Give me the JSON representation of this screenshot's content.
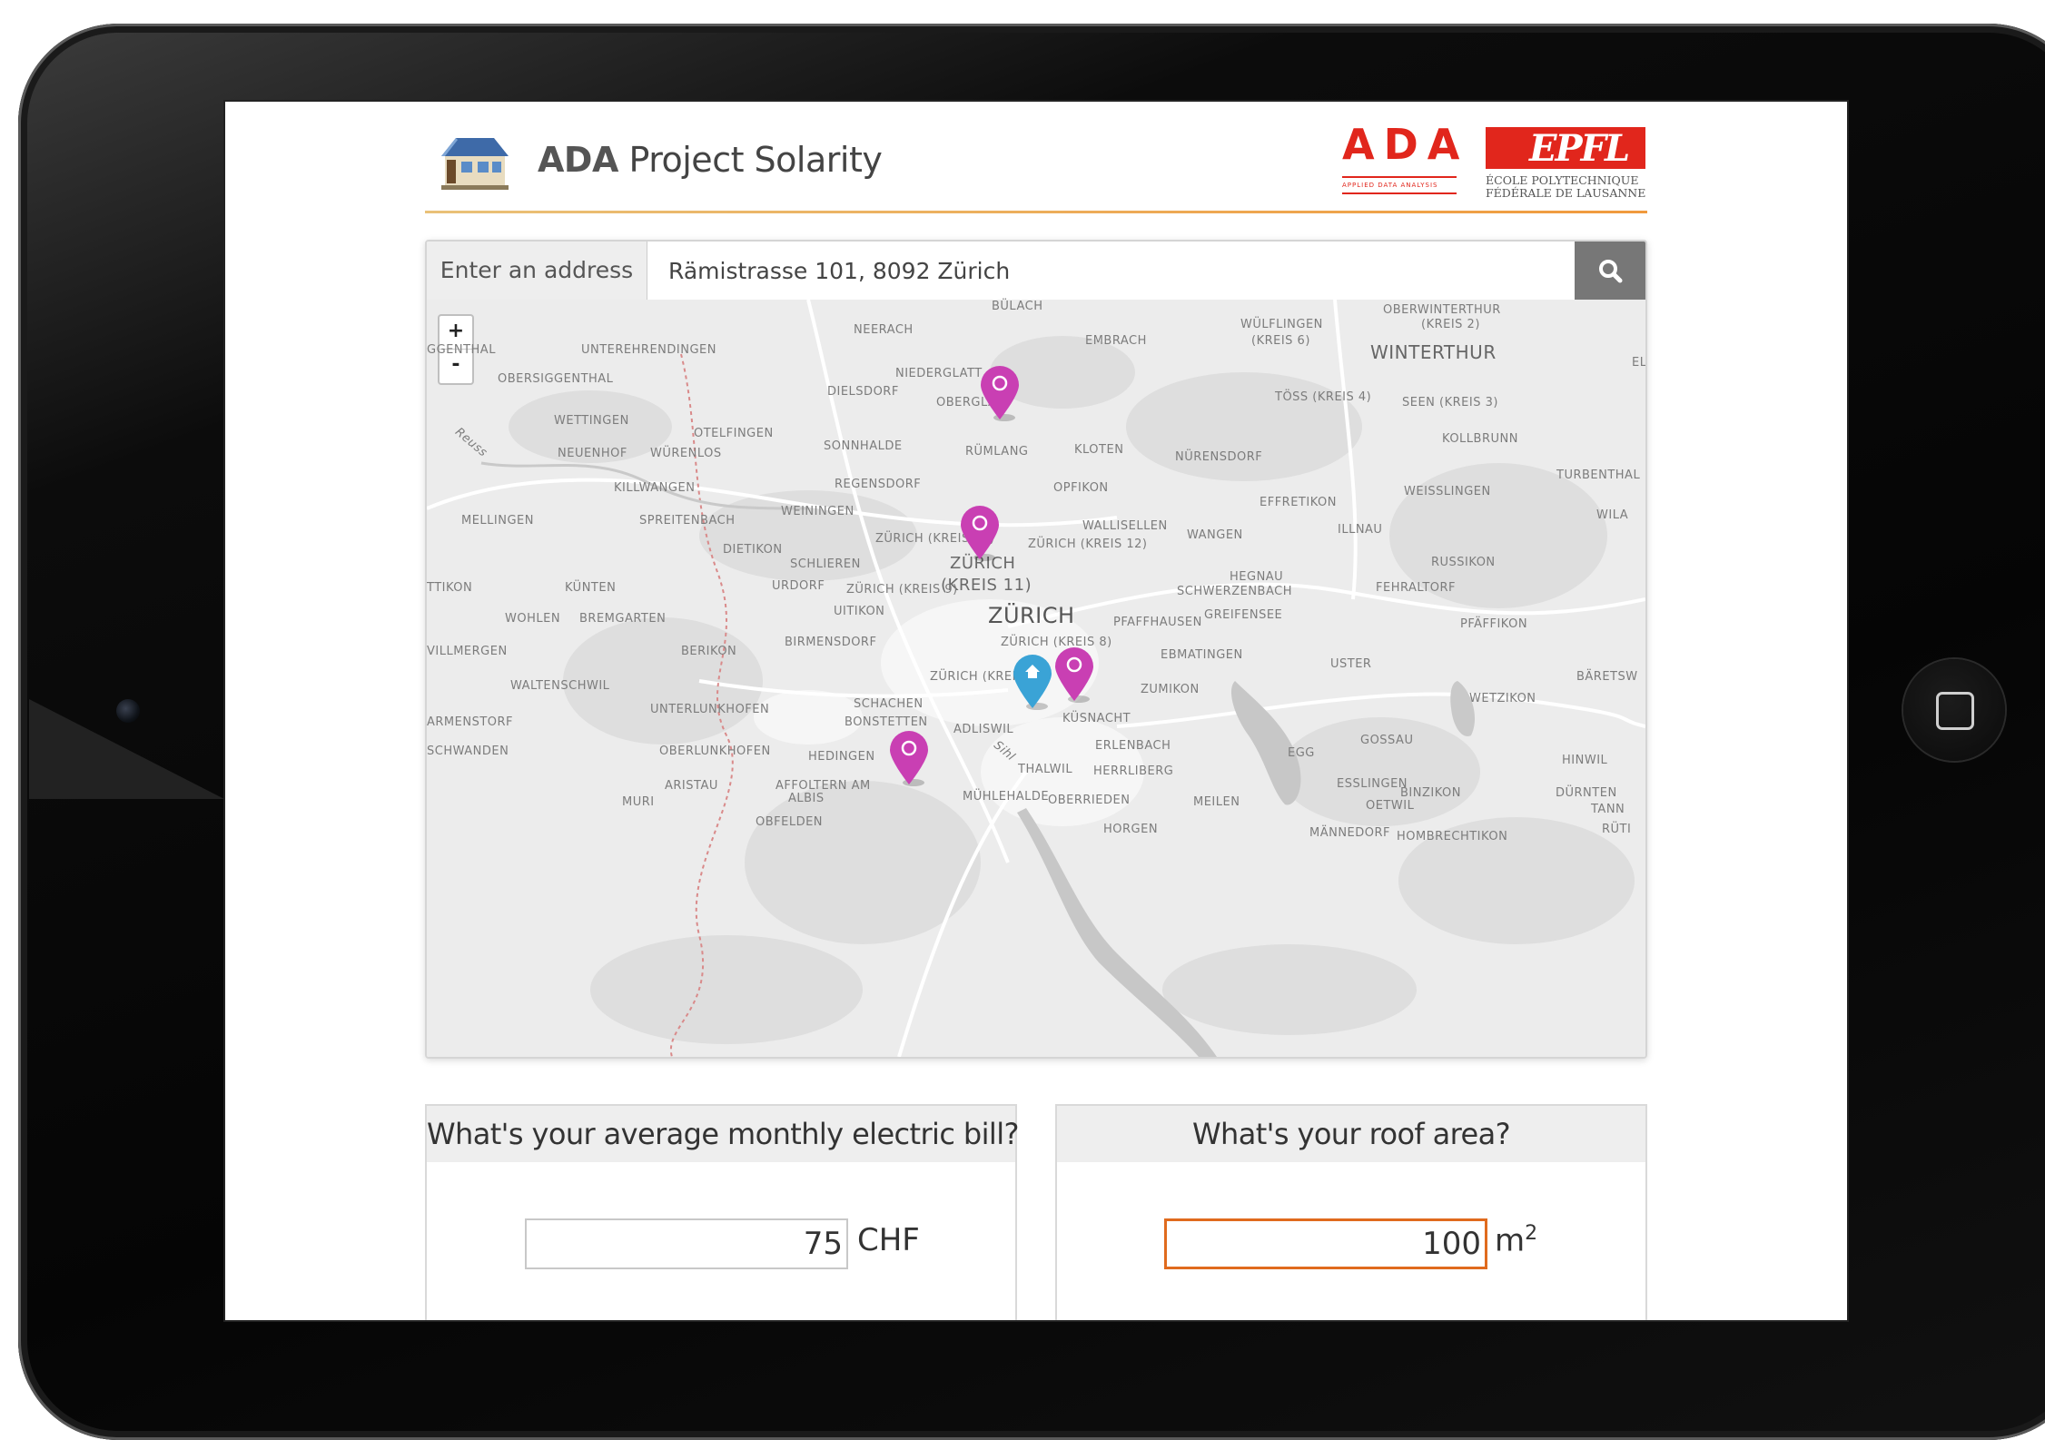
{
  "app": {
    "title_bold": "ADA",
    "title_rest": "Project Solarity"
  },
  "logos": {
    "ada_text": "ADA",
    "ada_subtitle": "APPLIED DATA ANALYSIS",
    "epfl_text": "EPFL",
    "epfl_subtitle": "ÉCOLE POLYTECHNIQUE\nFÉDÉRALE DE LAUSANNE"
  },
  "search": {
    "label": "Enter an address",
    "value": "Rämistrasse 101, 8092 Zürich",
    "button_icon": "search-icon"
  },
  "map": {
    "zoom_in": "+",
    "zoom_out": "-",
    "places": [
      "BÜLACH",
      "NEERACH",
      "EMBRACH",
      "WÜLFLINGEN",
      "(KREIS 6)",
      "OBERWINTERTHUR",
      "(KREIS 2)",
      "WINTERTHUR",
      "ELG",
      "GGENTHAL",
      "UNTEREHRENDINGEN",
      "OBERSIGGENTHAL",
      "NIEDERGLATT",
      "DIELSDORF",
      "OBERGLATT",
      "TÖSS (KREIS 4)",
      "SEEN (KREIS 3)",
      "WETTINGEN",
      "OTELFINGEN",
      "Reuss",
      "NEUENHOF",
      "WÜRENLOS",
      "SONNHALDE",
      "RÜMLANG",
      "KLOTEN",
      "NÜRENSDORF",
      "KOLLBRUNN",
      "TURBENTHAL",
      "KILLWANGEN",
      "REGENSDORF",
      "ZÜRICH",
      "(KREIS 11)",
      "OPFIKON",
      "EFFRETIKON",
      "WEISSLINGEN",
      "MELLINGEN",
      "SPREITENBACH",
      "WEININGEN",
      "WALLISELLEN",
      "WANGEN",
      "ILLNAU",
      "WILA",
      "ZÜRICH (KREIS 10)",
      "ZÜRICH (KREIS 12)",
      "DIETIKON",
      "RUSSIKON",
      "SCHLIEREN",
      "HEGNAU",
      "FEHRALTORF",
      "TTIKON",
      "KÜNTEN",
      "URDORF",
      "ZÜRICH (KREIS 9)",
      "ZÜRICH",
      "SCHWERZENBACH",
      "WOHLEN",
      "BREMGARTEN",
      "UITIKON",
      "PFAFFHAUSEN",
      "GREIFENSEE",
      "PFÄFFIKON",
      "BIRMENSDORF",
      "ZÜRICH (KREIS 8)",
      "VILLMERGEN",
      "BERIKON",
      "EBMATINGEN",
      "USTER",
      "ZÜRICH (KREIS 2)",
      "BÄRETSW",
      "WALTENSCHWIL",
      "ZUMIKON",
      "UNTERLUNKHOFEN",
      "SCHACHEN",
      "WETZIKON",
      "ARMENSTORF",
      "BONSTETTEN",
      "KÜSNACHT",
      "ADLISWIL",
      "Sihl",
      "GOSSAU",
      "SCHWANDEN",
      "OBERLUNKHOFEN",
      "HEDINGEN",
      "ERLENBACH",
      "EGG",
      "HINWIL",
      "ARISTAU",
      "THALWIL",
      "HERRLIBERG",
      "ESSLINGEN",
      "BINZIKON",
      "DÜRNTEN",
      "MURI",
      "AFFOLTERN AM",
      "ALBIS",
      "MÜHLEHALDE",
      "OBERRIEDEN",
      "MEILEN",
      "OETWIL",
      "TANN",
      "OBFELDEN",
      "HORGEN",
      "MÄNNEDORF",
      "HOMBRECHTIKON",
      "RÜTI"
    ]
  },
  "bill": {
    "question": "What's your average monthly electric bill?",
    "value": "75",
    "unit": "CHF"
  },
  "roof": {
    "question": "What's your roof area?",
    "value": "100",
    "unit": "m",
    "unit_sup": "2"
  },
  "colors": {
    "accent_red": "#e1261c",
    "solar_marker": "#c93fb3",
    "home_marker": "#3aa3d6",
    "focus_orange": "#e06b1e"
  }
}
